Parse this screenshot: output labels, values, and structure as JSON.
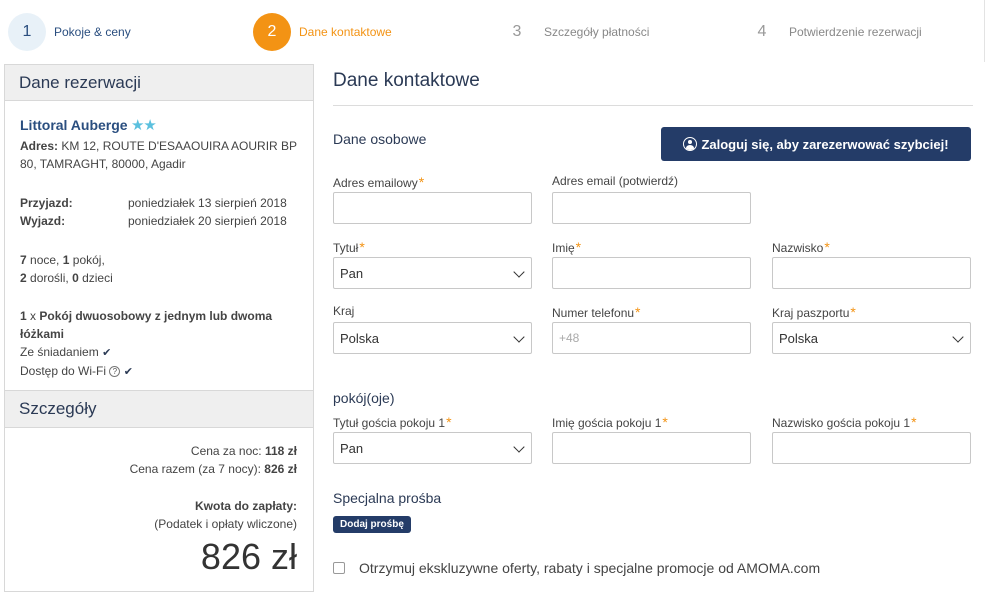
{
  "steps": [
    {
      "num": "1",
      "label": "Pokoje & ceny"
    },
    {
      "num": "2",
      "label": "Dane kontaktowe"
    },
    {
      "num": "3",
      "label": "Szczegóły płatności"
    },
    {
      "num": "4",
      "label": "Potwierdzenie rezerwacji"
    }
  ],
  "sidebar": {
    "title": "Dane rezerwacji",
    "hotel_name": "Littoral Auberge",
    "stars": "★★",
    "address_label": "Adres:",
    "address": "KM 12, ROUTE D'ESAAOUIRA AOURIR BP 80, TAMRAGHT, 80000, Agadir",
    "checkin_label": "Przyjazd:",
    "checkin": "poniedziałek 13 sierpień 2018",
    "checkout_label": "Wyjazd:",
    "checkout": "poniedziałek 20 sierpień 2018",
    "nights": "7",
    "nights_text": "noce,",
    "rooms": "1",
    "rooms_text": "pokój,",
    "adults": "2",
    "adults_text": "dorośli,",
    "children": "0",
    "children_text": "dzieci",
    "room_qty": "1",
    "room_x": "x",
    "room_name": "Pokój dwuosobowy z jednym lub dwoma łóżkami",
    "amenity1": "Ze śniadaniem",
    "amenity2": "Dostęp do Wi-Fi",
    "details_title": "Szczegóły",
    "price_night_label": "Cena za noc:",
    "price_night": "118 zł",
    "price_total_label": "Cena razem (za 7 nocy):",
    "price_total": "826 zł",
    "to_pay_label": "Kwota do zapłaty:",
    "tax_note": "(Podatek i opłaty wliczone)",
    "big_price": "826 zł"
  },
  "main": {
    "title": "Dane kontaktowe",
    "personal_title": "Dane osobowe",
    "login_button": "Zaloguj się, aby zarezerwować szybciej!",
    "fields": {
      "email": {
        "label": "Adres emailowy",
        "value": ""
      },
      "email_confirm": {
        "label": "Adres email (potwierdź)",
        "value": ""
      },
      "title": {
        "label": "Tytuł",
        "value": "Pan"
      },
      "first_name": {
        "label": "Imię",
        "value": ""
      },
      "last_name": {
        "label": "Nazwisko",
        "value": ""
      },
      "country": {
        "label": "Kraj",
        "value": "Polska"
      },
      "phone": {
        "label": "Numer telefonu",
        "placeholder": "+48"
      },
      "passport_country": {
        "label": "Kraj paszportu",
        "value": "Polska"
      }
    },
    "rooms_title": "pokój(oje)",
    "guest": {
      "title": {
        "label": "Tytuł gościa pokoju 1",
        "value": "Pan"
      },
      "first_name": {
        "label": "Imię gościa pokoju 1",
        "value": ""
      },
      "last_name": {
        "label": "Nazwisko gościa pokoju 1",
        "value": ""
      }
    },
    "special_title": "Specjalna prośba",
    "add_request": "Dodaj prośbę",
    "offers_checkbox": "Otrzymuj ekskluzywne oferty, rabaty i specjalne promocje od AMOMA.com",
    "required_mark": "*"
  },
  "colors": {
    "accent": "#f39314",
    "navy": "#243c68",
    "link": "#2a4e7f"
  }
}
